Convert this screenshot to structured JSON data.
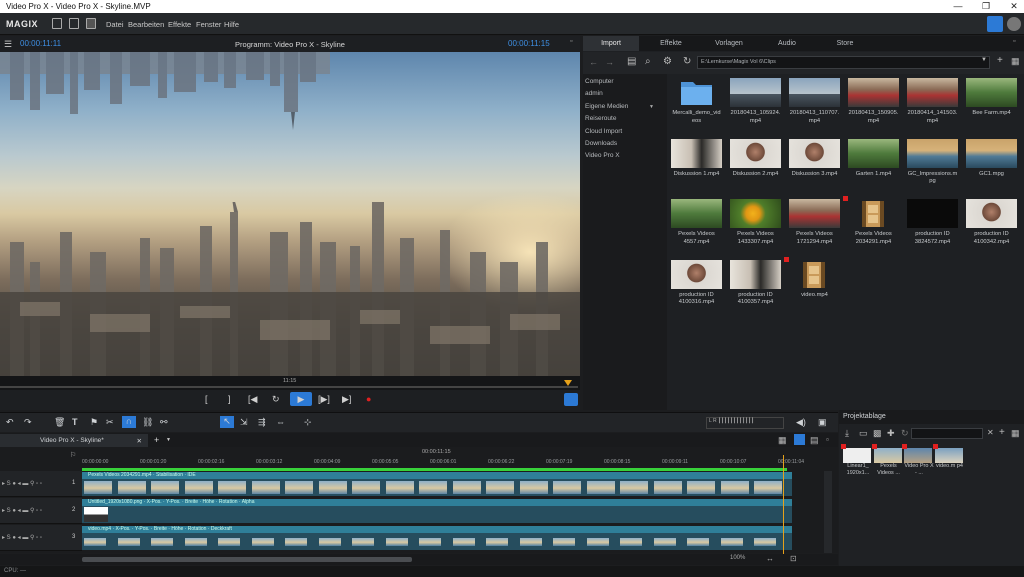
{
  "window": {
    "title": "Video Pro X - Video Pro X - Skyline.MVP",
    "min": "—",
    "max": "❐",
    "close": "✕"
  },
  "menubar": {
    "logo": "MAGIX",
    "items": [
      "Datei",
      "Bearbeiten",
      "Effekte",
      "Fenster",
      "Hilfe"
    ]
  },
  "preview": {
    "timecode_left": "00:00:11:11",
    "title": "Programm: Video Pro X - Skyline",
    "timecode_right": "00:00:11:15",
    "scrub_label": "11:15",
    "controls": {
      "in": "[",
      "out": "]",
      "prev": "[◀",
      "loop": "↻",
      "play": "▶",
      "next_marker": "[▶]",
      "next": "▶]",
      "record": "●"
    }
  },
  "pool": {
    "tabs": [
      "Import",
      "Effekte",
      "Vorlagen",
      "Audio",
      "Store"
    ],
    "active_tab": "Import",
    "path": "E:\\Lernkurse\\Magix Vol 6\\Clips",
    "tree": [
      "Computer",
      "admin",
      "Eigene Medien",
      "Reiseroute",
      "Cloud Import",
      "Downloads",
      "Video Pro X"
    ],
    "files": [
      {
        "name": "Mercalli_demo_vid eos",
        "kind": "folder"
      },
      {
        "name": "20180413_105924. mp4",
        "kind": "sky"
      },
      {
        "name": "20180413_110707. mp4",
        "kind": "sky"
      },
      {
        "name": "20180413_150905. mp4",
        "kind": "street"
      },
      {
        "name": "20180414_141503. mp4",
        "kind": "street"
      },
      {
        "name": "Bee Farm.mp4",
        "kind": "nature"
      },
      {
        "name": "Diskussion 1.mp4",
        "kind": "people"
      },
      {
        "name": "Diskussion 2.mp4",
        "kind": "face"
      },
      {
        "name": "Diskussion 3.mp4",
        "kind": "face"
      },
      {
        "name": "Garten 1.mp4",
        "kind": "nature"
      },
      {
        "name": "GC_Impressions.m pg",
        "kind": "sea"
      },
      {
        "name": "GC1.mpg",
        "kind": "sea"
      },
      {
        "name": "Pexels Videos 4557.mp4",
        "kind": "nature"
      },
      {
        "name": "Pexels Videos 1433307.mp4",
        "kind": "flower"
      },
      {
        "name": "Pexels Videos 1721294.mp4",
        "kind": "street"
      },
      {
        "name": "Pexels Videos 2034291.mp4",
        "kind": "film"
      },
      {
        "name": "production ID 3824572.mp4",
        "kind": "dark"
      },
      {
        "name": "production ID 4100342.mp4",
        "kind": "face"
      },
      {
        "name": "production ID 4100316.mp4",
        "kind": "face"
      },
      {
        "name": "production ID 4100357.mp4",
        "kind": "people"
      },
      {
        "name": "video.mp4",
        "kind": "film"
      }
    ]
  },
  "timeline": {
    "tab": "Video Pro X - Skyline*",
    "add_tab": "+",
    "timecodes": [
      "00:00:00:00",
      "00:00:01:20",
      "00:00:02:16",
      "00:00:03:12",
      "00:00:04:09",
      "00:00:05:05",
      "00:00:06:01",
      "00:00:06:22",
      "00:00:07:19",
      "00:00:08:15",
      "00:00:09:11",
      "00:00:10:07",
      "00:00:11:04"
    ],
    "ruler_center": "00:00:11:15",
    "tracks": [
      {
        "num": "1",
        "label": "Pexels Videos 2034291.mp4 · Stabilisation · IDE"
      },
      {
        "num": "2",
        "label": "Untitled_1920x1080.png · X-Pos. · Y-Pos. · Breite · Höhe · Rotation · Alpha"
      },
      {
        "num": "3",
        "label": "video.mp4 · X-Pos. · Y-Pos. · Breite · Höhe · Rotation · Deckkraft"
      }
    ],
    "zoom": "100%"
  },
  "bin": {
    "title": "Projektablage",
    "items": [
      "Linear1_ 1920x1...",
      "Pexels Videos ...",
      "Video Pro X - ...",
      "video.m p4"
    ]
  },
  "status": "CPU: —"
}
